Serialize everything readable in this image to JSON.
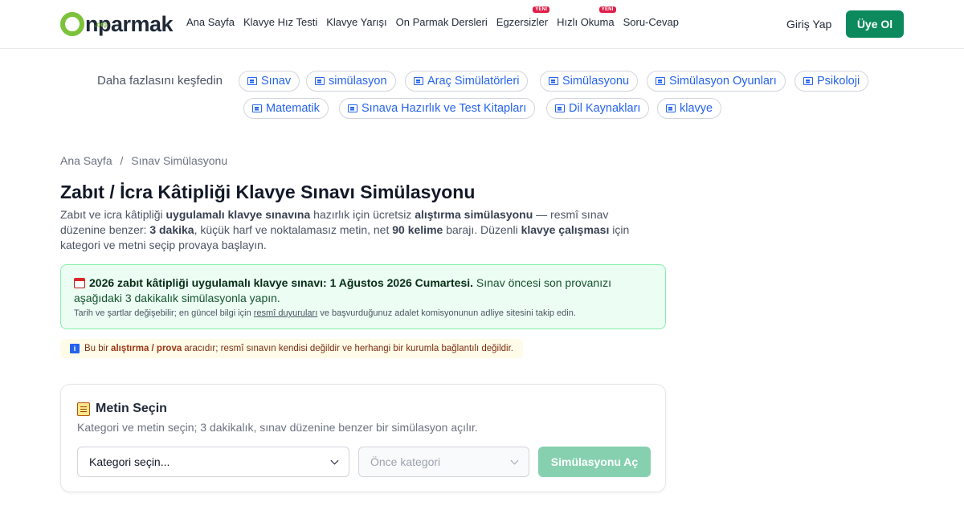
{
  "header": {
    "logo_text": "nparmak",
    "logo_suffix": ".org",
    "nav": [
      {
        "label": "Ana Sayfa"
      },
      {
        "label": "Klavye Hız Testi"
      },
      {
        "label": "Klavye Yarışı"
      },
      {
        "label": "On Parmak Dersleri"
      },
      {
        "label": "Egzersizler",
        "badge": "YENİ"
      },
      {
        "label": "Hızlı Okuma",
        "badge": "YENİ"
      },
      {
        "label": "Soru-Cevap"
      }
    ],
    "login_label": "Giriş Yap",
    "signup_label": "Üye Ol"
  },
  "discover": {
    "label": "Daha fazlasını keşfedin",
    "chips": [
      "Sınav",
      "simülasyon",
      "Araç Simülatörleri",
      "Simülasyonu",
      "Simülasyon Oyunları",
      "Psikoloji",
      "Matematik",
      "Sınava Hazırlık ve Test Kitapları",
      "Dil Kaynakları",
      "klavye"
    ]
  },
  "breadcrumb": {
    "home": "Ana Sayfa",
    "separator": "/",
    "current": "Sınav Simülasyonu"
  },
  "page": {
    "title": "Zabıt / İcra Kâtipliği Klavye Sınavı Simülasyonu",
    "intro": {
      "p1": "Zabıt ve icra kâtipliği ",
      "b1": "uygulamalı klavye sınavına",
      "p2": " hazırlık için ücretsiz ",
      "b2": "alıştırma simülasyonu",
      "p3": " — resmî sınav düzenine benzer: ",
      "b3": "3 dakika",
      "p4": ", küçük harf ve noktalamasız metin, net ",
      "b4": "90 kelime",
      "p5": " barajı. Düzenli ",
      "b5": "klavye çalışması",
      "p6": " için kategori ve metni seçip provaya başlayın."
    }
  },
  "notice": {
    "bold": "2026 zabıt kâtipliği uygulamalı klavye sınavı: 1 Ağustos 2026 Cumartesi.",
    "text": " Sınav öncesi son provanızı aşağıdaki 3 dakikalık simülasyonla yapın.",
    "sub_pre": "Tarih ve şartlar değişebilir; en güncel bilgi için ",
    "sub_link": "resmî duyuruları",
    "sub_post": " ve başvurduğunuz adalet komisyonunun adliye sitesini takip edin."
  },
  "info": {
    "icon": "i",
    "pre": "Bu bir",
    "bold": "alıştırma / prova",
    "post": "aracıdır; resmî sınavın kendisi değildir ve herhangi bir kurumla bağlantılı değildir."
  },
  "card": {
    "title": "Metin Seçin",
    "description": "Kategori ve metin seçin; 3 dakikalık, sınav düzenine benzer bir simülasyon açılır.",
    "category_select": "Kategori seçin...",
    "text_select": "Önce kategori",
    "open_button": "Simülasyonu Aç"
  },
  "colors": {
    "brand_green": "#0c8a5e",
    "logo_green": "#7cc23a",
    "link_blue": "#2563eb",
    "badge_red": "#e11d48"
  }
}
